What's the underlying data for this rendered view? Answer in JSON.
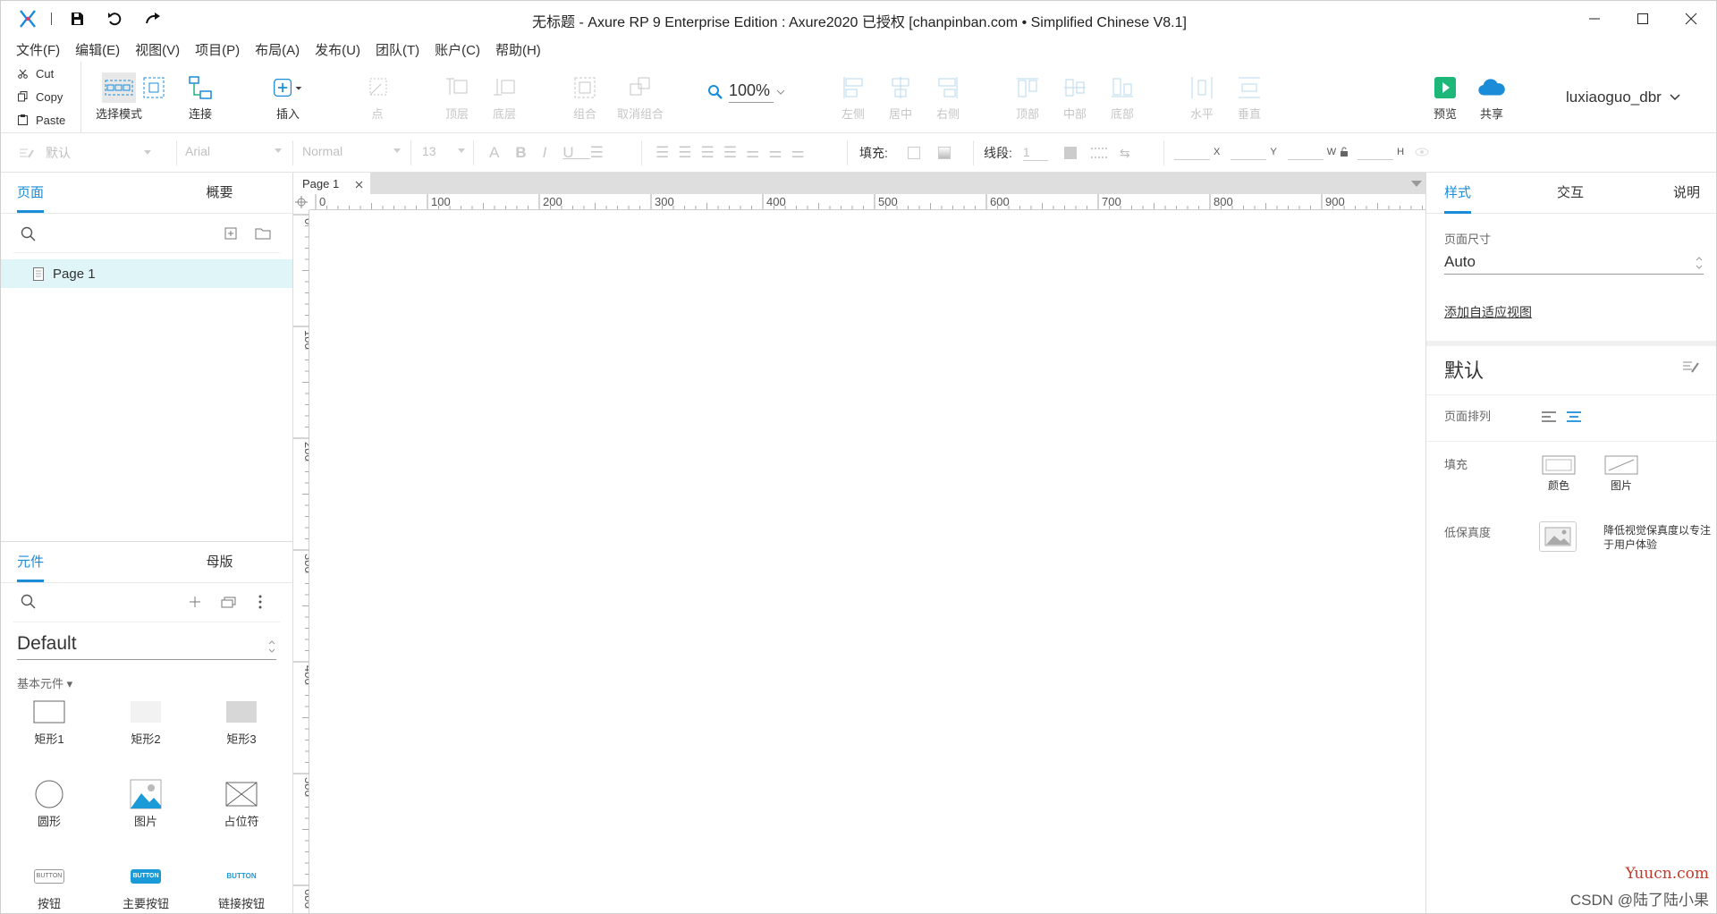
{
  "titlebar": {
    "title": "无标题 - Axure RP 9 Enterprise Edition : Axure2020 已授权    [chanpinban.com • Simplified Chinese V8.1]"
  },
  "menu": [
    "文件(F)",
    "编辑(E)",
    "视图(V)",
    "项目(P)",
    "布局(A)",
    "发布(U)",
    "团队(T)",
    "账户(C)",
    "帮助(H)"
  ],
  "clipboard": {
    "cut": "Cut",
    "copy": "Copy",
    "paste": "Paste"
  },
  "toolbar": {
    "select_mode": "选择模式",
    "connect": "连接",
    "insert": "插入",
    "point": "点",
    "top_layer": "顶层",
    "bottom_layer": "底层",
    "group": "组合",
    "ungroup": "取消组合",
    "zoom": "100%",
    "align_left": "左侧",
    "align_center": "居中",
    "align_right": "右侧",
    "align_top": "顶部",
    "align_middle": "中部",
    "align_bottom": "底部",
    "dist_h": "水平",
    "dist_v": "垂直",
    "preview": "预览",
    "share": "共享",
    "user": "luxiaoguo_dbr"
  },
  "format": {
    "style": "默认",
    "font": "Arial",
    "weight": "Normal",
    "size": "13",
    "fill_label": "填充:",
    "stroke_label": "线段:",
    "stroke_value": "1",
    "x": "X",
    "y": "Y",
    "w": "W",
    "h": "H"
  },
  "left_panel": {
    "tabs": [
      "页面",
      "概要"
    ],
    "pages": [
      "Page 1"
    ],
    "lib_tabs": [
      "元件",
      "母版"
    ],
    "library": "Default",
    "category": "基本元件 ▾",
    "widgets": [
      {
        "label": "矩形1",
        "icon": "rect1-icon"
      },
      {
        "label": "矩形2",
        "icon": "rect2-icon"
      },
      {
        "label": "矩形3",
        "icon": "rect3-icon"
      },
      {
        "label": "圆形",
        "icon": "circle-icon"
      },
      {
        "label": "图片",
        "icon": "image-icon"
      },
      {
        "label": "占位符",
        "icon": "placeholder-icon"
      },
      {
        "label": "按钮",
        "icon": "button-icon",
        "badge": "BUTTON"
      },
      {
        "label": "主要按钮",
        "icon": "primary-button-icon",
        "badge": "BUTTON"
      },
      {
        "label": "链接按钮",
        "icon": "link-button-icon",
        "badge": "BUTTON"
      }
    ]
  },
  "canvas": {
    "tab": "Page 1",
    "ruler_h": [
      "0",
      "100",
      "200",
      "300",
      "400",
      "500",
      "600",
      "700",
      "800",
      "900"
    ],
    "ruler_v": [
      "0",
      "100",
      "200",
      "300",
      "400",
      "500",
      "600"
    ]
  },
  "right_panel": {
    "tabs": [
      "样式",
      "交互",
      "说明"
    ],
    "page_size_label": "页面尺寸",
    "page_size_value": "Auto",
    "adaptive_link": "添加自适应视图",
    "style_name": "默认",
    "page_align_label": "页面排列",
    "fill_label": "填充",
    "fill_color": "颜色",
    "fill_image": "图片",
    "low_fidelity_label": "低保真度",
    "low_fidelity_desc": "降低视觉保真度以专注于用户体验"
  },
  "watermark": {
    "line1": "Yuucn.com",
    "line2": "CSDN @陆了陆小果"
  },
  "colors": {
    "accent": "#1a8cd8",
    "selected_row": "#dff5f7",
    "preview_green": "#1db77a"
  }
}
